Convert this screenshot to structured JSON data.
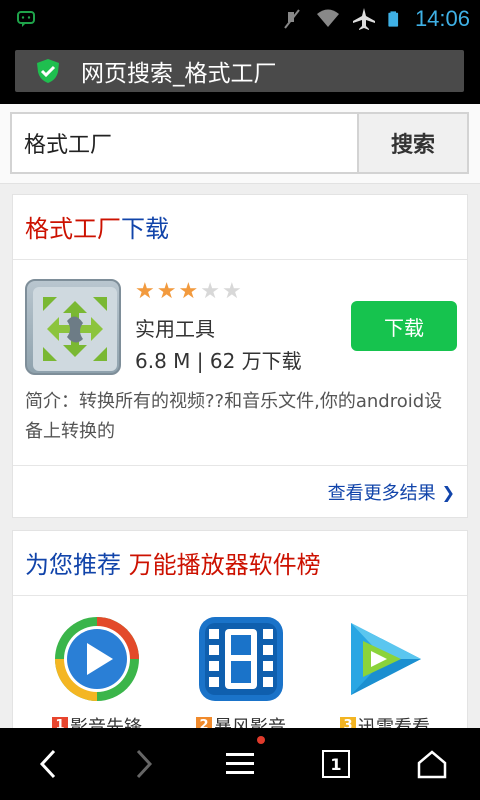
{
  "status_bar": {
    "time": "14:06"
  },
  "title_bar": {
    "title": "网页搜索_格式工厂"
  },
  "search": {
    "query": "格式工厂",
    "button_label": "搜索"
  },
  "card1": {
    "title_red": "格式工厂",
    "title_blue": "下载",
    "app": {
      "rating": 3,
      "rating_max": 5,
      "category": "实用工具",
      "meta": "6.8 M | 62 万下载",
      "download_label": "下载",
      "description": "简介：转换所有的视频??和音乐文件,你的android设备上转换的"
    },
    "more_link": "查看更多结果"
  },
  "card2": {
    "title_blue": "为您推荐",
    "title_red": "万能播放器软件榜",
    "apps": [
      {
        "rank": "1",
        "name": "影音先锋",
        "rank_color": "#e8452e"
      },
      {
        "rank": "2",
        "name": "暴风影音",
        "rank_color": "#f08a2c"
      },
      {
        "rank": "3",
        "name": "迅雷看看",
        "rank_color": "#f3b523"
      }
    ]
  },
  "colors": {
    "status_accent": "#3fb1e6",
    "download_green": "#16c34e",
    "title_red": "#cc1100",
    "link_blue": "#1144aa"
  },
  "icons": {
    "status_left": "chat-icon",
    "status_mute": "muted-icon",
    "status_wifi": "wifi-icon",
    "status_airplane": "airplane-icon",
    "status_battery": "battery-icon",
    "title_shield": "shield-check-icon",
    "nav_back": "chevron-left-icon",
    "nav_forward": "chevron-right-icon",
    "nav_menu": "menu-icon",
    "nav_tabs": "tabs-icon",
    "nav_home": "home-icon"
  },
  "bottom_nav": {
    "tabs_count": "1"
  }
}
